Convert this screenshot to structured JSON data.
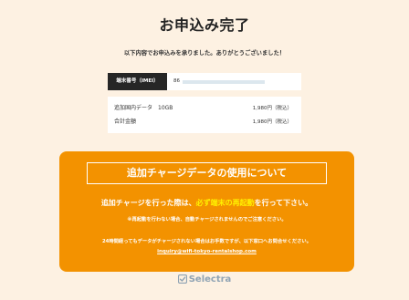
{
  "page": {
    "title": "お申込み完了",
    "subtitle": "以下内容でお申込みを承りました。ありがとうございました！"
  },
  "device": {
    "imei_label": "端末番号（IMEI）",
    "imei_value_prefix": "86"
  },
  "summary": {
    "items": [
      {
        "label": "追加国内データ　10GB",
        "price": "1,980円（税込）"
      },
      {
        "label": "合計金額",
        "price": "1,980円（税込）"
      }
    ]
  },
  "notice": {
    "title": "追加チャージデータの使用について",
    "main_prefix": "追加チャージを行った際は、",
    "main_emphasis": "必ず端末の再起動",
    "main_suffix": "を行って下さい。",
    "sub": "※再起動を行わない場合、自動チャージされませんのでご注意ください。",
    "contact": "24時間経ってもデータがチャージされない場合はお手数ですが、以下窓口へお問合せください。",
    "email": "inquiry@wifi-tokyo-rentalshop.com"
  },
  "brand": {
    "name": "Selectra",
    "icon": "selectra-check-icon"
  },
  "colors": {
    "background": "#FDF1E2",
    "accent": "#F39200",
    "highlight": "#FFF100",
    "label_bg": "#262626",
    "brand": "#8FA3B4"
  }
}
